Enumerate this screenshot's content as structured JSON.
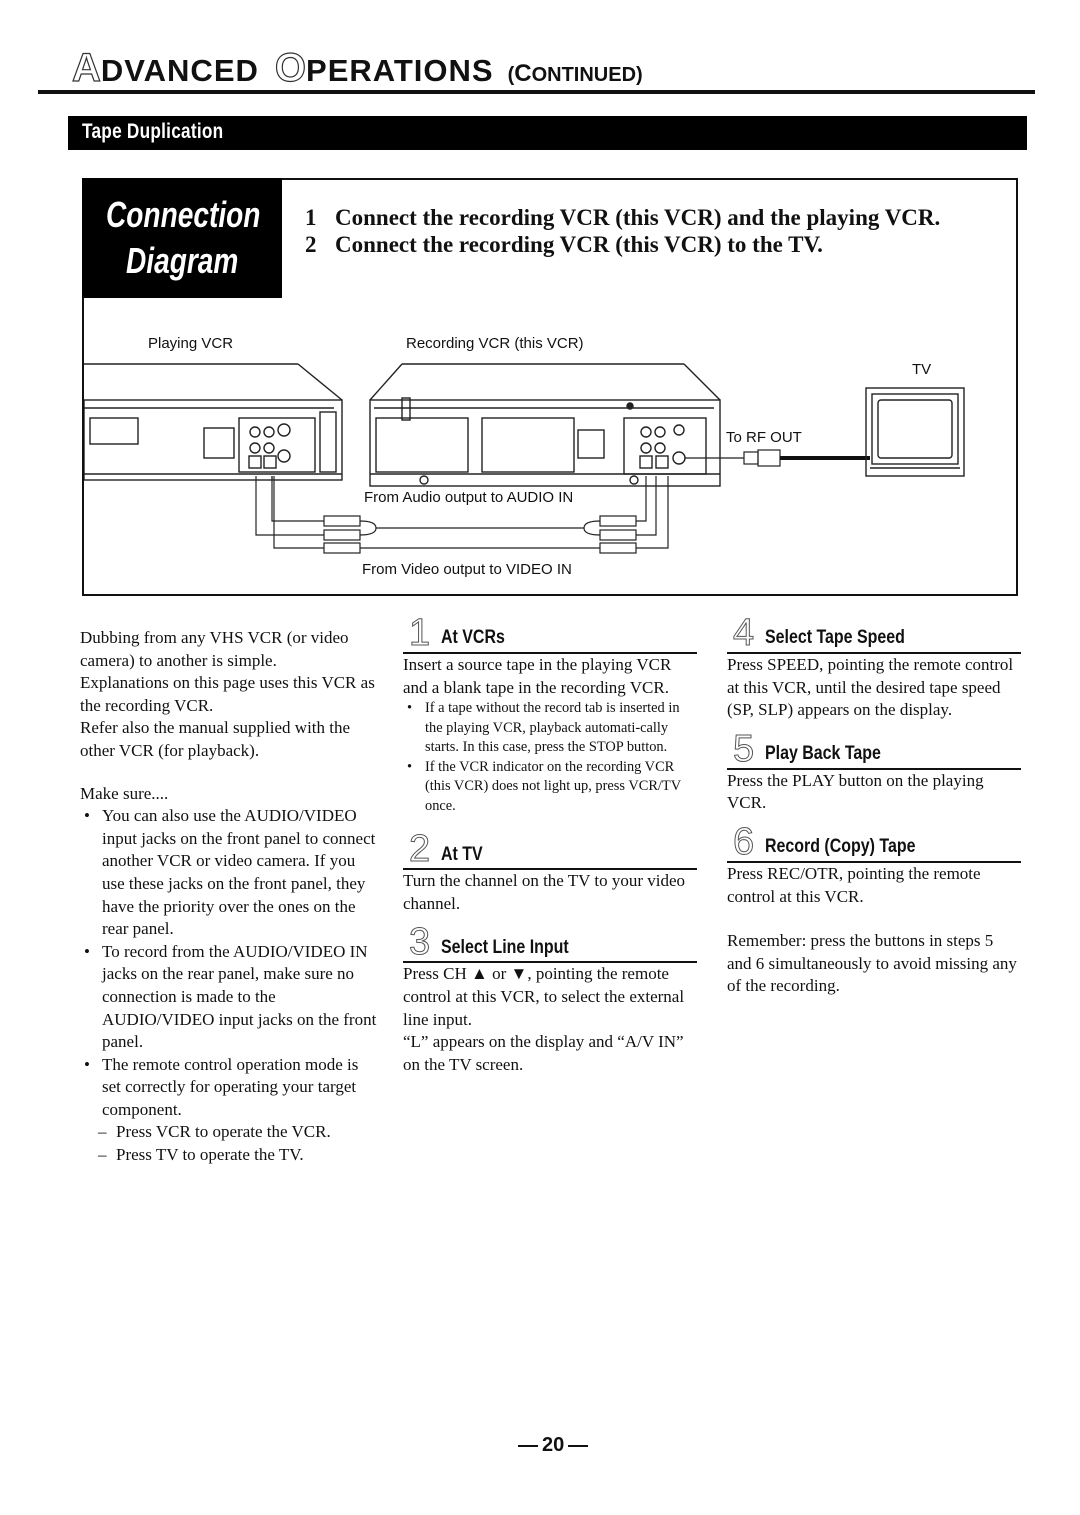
{
  "header": {
    "title_cap1": "A",
    "title_word1": "DVANCED",
    "title_cap2": "O",
    "title_word2": "PERATIONS",
    "continued_open": "(",
    "continued_cap": "C",
    "continued_rest": "ONTINUED",
    "continued_close": ")"
  },
  "section": {
    "title": "Tape Duplication"
  },
  "connection": {
    "box_line1": "Connection",
    "box_line2": "Diagram",
    "steps": [
      {
        "num": "1",
        "text": "Connect the recording VCR (this VCR) and the playing VCR."
      },
      {
        "num": "2",
        "text": "Connect the recording VCR (this VCR) to the TV."
      }
    ],
    "labels": {
      "playing_vcr": "Playing VCR",
      "recording_vcr": "Recording VCR (this VCR)",
      "tv": "TV",
      "rf_out": "To RF OUT",
      "audio": "From Audio output to AUDIO IN",
      "video": "From Video output to VIDEO IN"
    }
  },
  "intro": {
    "paragraphs": [
      "Dubbing from any VHS VCR (or video camera) to another is simple.",
      "Explanations on this page uses this VCR as the recording VCR.",
      "Refer also the manual supplied with the other VCR (for playback)."
    ],
    "make_sure_title": "Make sure....",
    "bullets": [
      "You can also use the AUDIO/VIDEO input jacks on the front panel to connect another VCR or video camera. If you use these jacks on the front panel, they have the priority over the ones on the rear panel.",
      "To record from the AUDIO/VIDEO IN jacks on the rear panel, make sure no connection is made to the AUDIO/VIDEO input jacks on the front panel.",
      "The remote control operation mode is set correctly for operating your target component."
    ],
    "dashes": [
      "Press VCR to operate the VCR.",
      "Press TV to operate the TV."
    ]
  },
  "steps": [
    {
      "num": "1",
      "title": "At VCRs",
      "body": "Insert a source tape in the playing VCR and a blank tape in the recording VCR.",
      "notes": [
        "If a tape without the record tab is inserted in the playing VCR, playback automati-cally starts. In this case, press the STOP button.",
        "If the VCR indicator on the recording VCR (this VCR) does not light up, press VCR/TV once."
      ]
    },
    {
      "num": "2",
      "title": "At TV",
      "body": "Turn the channel on the TV to your video channel."
    },
    {
      "num": "3",
      "title": "Select Line Input",
      "body": "Press CH ▲ or ▼, pointing the remote control at this VCR, to select the external line input.",
      "body2": "“L” appears on the display and “A/V IN” on the TV screen."
    },
    {
      "num": "4",
      "title": "Select Tape Speed",
      "body": "Press SPEED, pointing the remote control at this VCR, until the desired tape speed (SP, SLP) appears on the display."
    },
    {
      "num": "5",
      "title": "Play Back Tape",
      "body": "Press the PLAY button on the playing VCR."
    },
    {
      "num": "6",
      "title": "Record (Copy) Tape",
      "body": "Press REC/OTR, pointing the remote control at this VCR."
    }
  ],
  "remember": "Remember: press the buttons in steps 5 and 6 simultaneously to avoid missing any of the recording.",
  "page_number": "20"
}
